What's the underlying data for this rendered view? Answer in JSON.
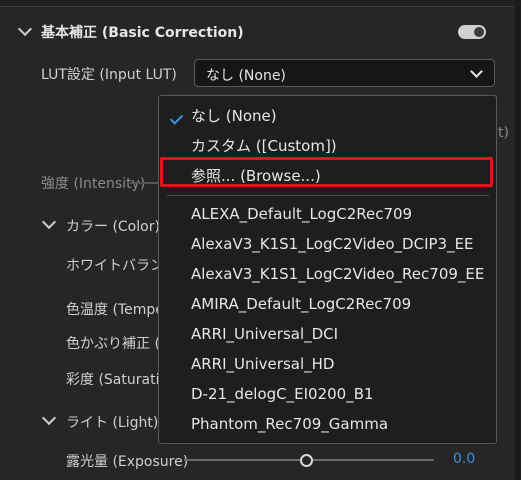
{
  "basic_correction": {
    "title": "基本補正 (Basic Correction)",
    "lut_label": "LUT設定 (Input LUT)",
    "lut_selected": "なし (None)",
    "intensity_label": "強度 (Intensity)"
  },
  "color": {
    "title": "カラー (Color)",
    "white_balance": "ホワイトバラン",
    "temperature": "色温度 (Tempe",
    "tint": "色かぶり補正 (",
    "saturation": "彩度 (Saturatio"
  },
  "light": {
    "title": "ライト (Light)",
    "exposure_label": "露光量 (Exposure)",
    "exposure_value": "0.0"
  },
  "peek_text": "t)",
  "dropdown": {
    "items": [
      "なし (None)",
      "カスタム ([Custom])",
      "参照... (Browse...)",
      "ALEXA_Default_LogC2Rec709",
      "AlexaV3_K1S1_LogC2Video_DCIP3_EE",
      "AlexaV3_K1S1_LogC2Video_Rec709_EE",
      "AMIRA_Default_LogC2Rec709",
      "ARRI_Universal_DCI",
      "ARRI_Universal_HD",
      "D-21_delogC_EI0200_B1",
      "Phantom_Rec709_Gamma"
    ],
    "selected_index": 0,
    "highlighted_index": 2
  },
  "colors": {
    "accent": "#3d8fe0",
    "highlight_border": "#e0141c"
  }
}
